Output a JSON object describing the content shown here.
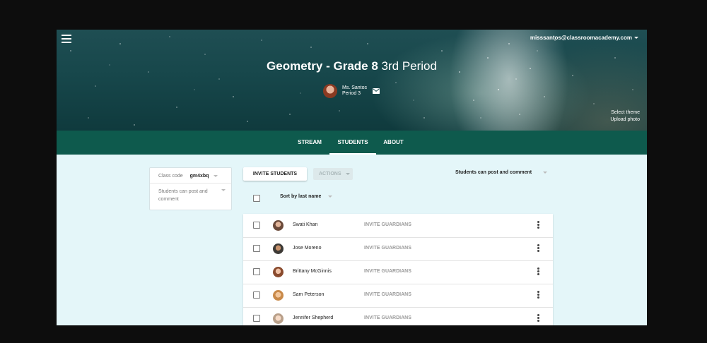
{
  "header": {
    "account_email": "misssantos@classroomacademy.com",
    "class_name": "Geometry - Grade 8",
    "class_section": "3rd Period",
    "teacher_name": "Ms. Santos",
    "teacher_period": "Period 3",
    "select_theme": "Select theme",
    "upload_photo": "Upload photo"
  },
  "tabs": [
    {
      "label": "STREAM",
      "active": false
    },
    {
      "label": "STUDENTS",
      "active": true
    },
    {
      "label": "ABOUT",
      "active": false
    }
  ],
  "sidebar": {
    "class_code_label": "Class code",
    "class_code_value": "gm4xbq",
    "post_setting": "Students can post and comment"
  },
  "toolbar": {
    "invite_students": "INVITE STUDENTS",
    "actions": "ACTIONS",
    "post_permission": "Students can post and comment"
  },
  "list_header": {
    "sort_label": "Sort by last name"
  },
  "students": [
    {
      "name": "Swati Khan",
      "guardian_action": "INVITE GUARDIANS",
      "avatar_color": "#6b4a3a"
    },
    {
      "name": "Jose Moreno",
      "guardian_action": "INVITE GUARDIANS",
      "avatar_color": "#3d3a36"
    },
    {
      "name": "Brittany McGinnis",
      "guardian_action": "INVITE GUARDIANS",
      "avatar_color": "#8a4b2e"
    },
    {
      "name": "Sam Peterson",
      "guardian_action": "INVITE GUARDIANS",
      "avatar_color": "#c98a4a"
    },
    {
      "name": "Jennifer Shepherd",
      "guardian_action": "INVITE GUARDIANS",
      "avatar_color": "#b9a08a"
    }
  ],
  "colors": {
    "tab_bar": "#0e5a4d",
    "page_background": "#e4f6f9"
  }
}
